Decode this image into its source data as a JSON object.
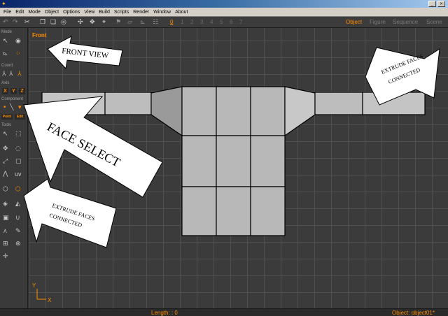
{
  "window": {
    "minimize_glyph": "_",
    "close_glyph": "×"
  },
  "menu": [
    "File",
    "Edit",
    "Mode",
    "Object",
    "Options",
    "View",
    "Build",
    "Scripts",
    "Render",
    "Window",
    "About"
  ],
  "toolbar": {
    "numbers": [
      "0",
      "1",
      "2",
      "3",
      "4",
      "5",
      "6",
      "7"
    ],
    "active_number": "0",
    "rooms": [
      "Object",
      "Figure",
      "Sequence",
      "Scene"
    ],
    "active_room": "Object"
  },
  "left_panel": {
    "sections": {
      "mode": "Mode",
      "coord": "Coord",
      "axis": "Axis",
      "component": "Component",
      "tools": "Tools"
    },
    "axis_buttons": [
      "X",
      "Y",
      "Z"
    ],
    "component_buttons": [
      "Point",
      "Edit"
    ],
    "uv_label": "uv"
  },
  "viewport": {
    "label": "Front",
    "axis_y": "Y",
    "axis_x": "X"
  },
  "annotations": {
    "front_view": "FRONT VIEW",
    "face_select": "FACE SELECT",
    "extrude_left_line1": "EXTRUDE FACES",
    "extrude_left_line2": "CONNECTED",
    "extrude_right_line1": "EXTRUDE FACES",
    "extrude_right_line2": "CONNECTED"
  },
  "status": {
    "length": "Length: : 0",
    "object": "Object: object01*"
  },
  "colors": {
    "accent": "#ff8c00",
    "face_light": "#c4c4c4",
    "face_mid": "#b4b4b4",
    "face_dark": "#999999"
  }
}
